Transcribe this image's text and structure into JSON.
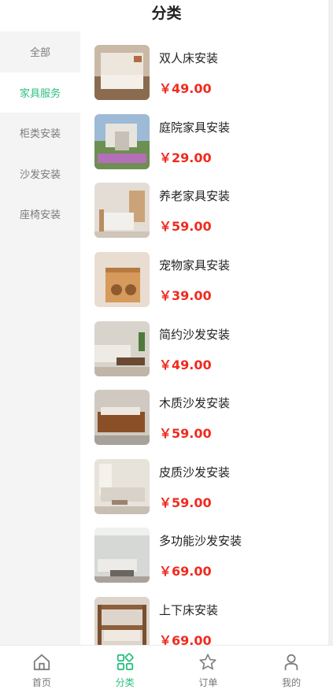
{
  "header": {
    "title": "分类"
  },
  "sidebar": {
    "items": [
      {
        "label": "全部",
        "active": false
      },
      {
        "label": "家具服务",
        "active": true
      },
      {
        "label": "柜类安装",
        "active": false
      },
      {
        "label": "沙发安装",
        "active": false
      },
      {
        "label": "座椅安装",
        "active": false
      }
    ]
  },
  "products": [
    {
      "name": "双人床安装",
      "price": "￥49.00"
    },
    {
      "name": "庭院家具安装",
      "price": "￥29.00"
    },
    {
      "name": "养老家具安装",
      "price": "￥59.00"
    },
    {
      "name": "宠物家具安装",
      "price": "￥39.00"
    },
    {
      "name": "简约沙发安装",
      "price": "￥49.00"
    },
    {
      "name": "木质沙发安装",
      "price": "￥59.00"
    },
    {
      "name": "皮质沙发安装",
      "price": "￥59.00"
    },
    {
      "name": "多功能沙发安装",
      "price": "￥69.00"
    },
    {
      "name": "上下床安装",
      "price": "￥69.00"
    }
  ],
  "tabbar": {
    "items": [
      {
        "label": "首页",
        "icon": "home-icon",
        "active": false
      },
      {
        "label": "分类",
        "icon": "category-icon",
        "active": true
      },
      {
        "label": "订单",
        "icon": "star-icon",
        "active": false
      },
      {
        "label": "我的",
        "icon": "user-icon",
        "active": false
      }
    ]
  },
  "colors": {
    "accent": "#2bbf7f",
    "price": "#f02a1e",
    "sidebar_bg": "#f4f4f4"
  }
}
